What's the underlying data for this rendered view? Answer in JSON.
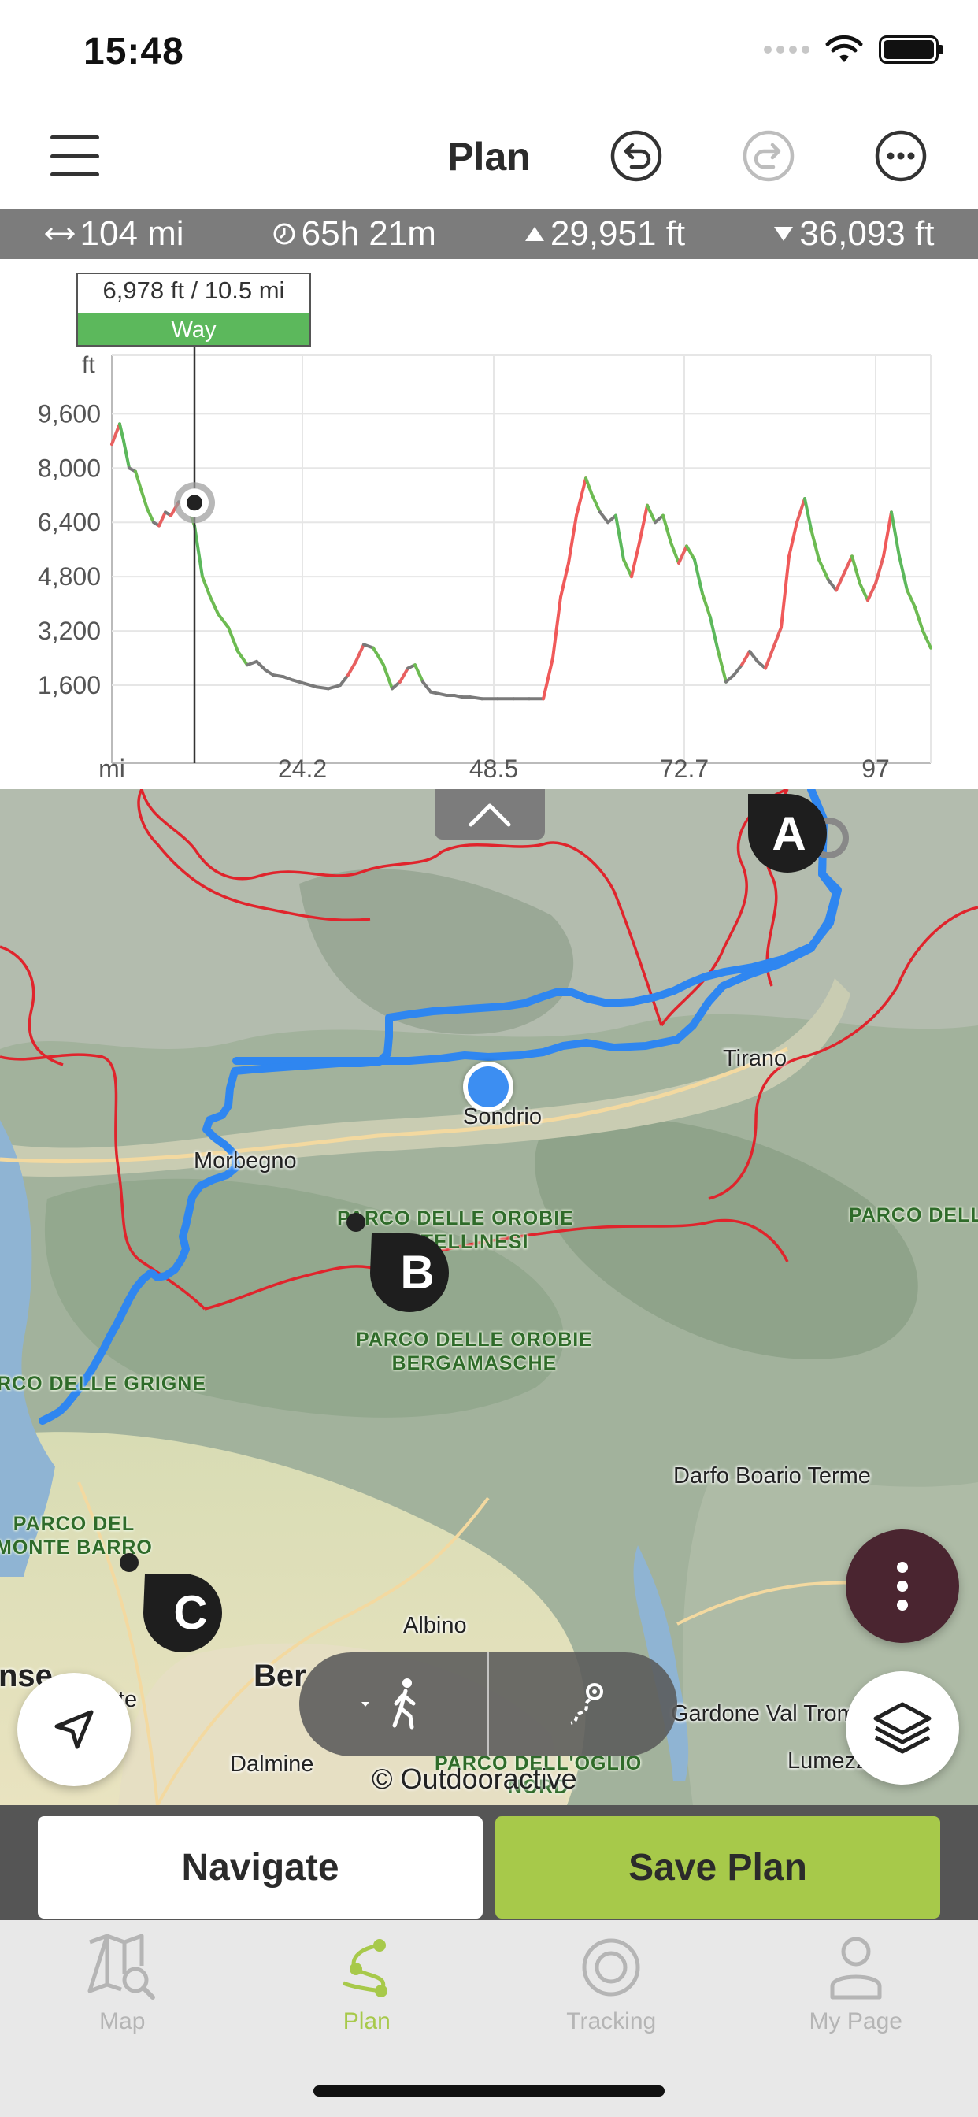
{
  "status_bar": {
    "time": "15:48"
  },
  "header": {
    "title": "Plan",
    "menu_icon": "hamburger-menu-icon",
    "undo_icon": "undo-icon",
    "redo_icon": "redo-icon",
    "more_icon": "more-horizontal-icon"
  },
  "stats": {
    "distance": "104 mi",
    "duration": "65h 21m",
    "ascent": "29,951 ft",
    "descent": "36,093 ft"
  },
  "chart_data": {
    "type": "line",
    "ylabel": "ft",
    "xlabel": "mi",
    "y_ticks": [
      "9,600",
      "8,000",
      "6,400",
      "4,800",
      "3,200",
      "1,600"
    ],
    "x_ticks": [
      "24.2",
      "48.5",
      "72.7",
      "97"
    ],
    "xlim": [
      0,
      104
    ],
    "ylim": [
      0,
      11000
    ],
    "tooltip": {
      "value": "6,978 ft / 10.5 mi",
      "surface": "Way"
    },
    "marker": {
      "x": 10.5,
      "y": 6978
    },
    "series": [
      {
        "x": [
          0,
          1,
          1.5,
          2.2,
          3,
          3.8,
          4.5,
          5.3,
          6,
          6.8,
          7.5,
          8.5,
          9.5,
          10.5,
          11.5,
          12.5,
          13.5,
          14.8,
          16,
          17.2,
          18.4,
          19.5,
          20.5,
          21.8,
          23,
          24.5,
          26,
          27.5,
          29,
          30,
          31,
          32,
          33.2,
          34.5,
          35.6,
          36.6,
          37.6,
          38.5,
          39.5,
          40.5,
          41.5,
          42.5,
          43.5,
          44.5,
          45.5,
          47,
          49,
          51,
          53,
          54.8,
          56,
          57,
          58,
          59,
          60.2,
          61,
          62,
          63,
          64,
          65,
          66,
          67,
          68,
          69,
          70,
          71,
          72,
          73,
          74,
          75,
          76,
          77,
          78,
          79,
          80,
          81,
          82,
          83,
          84,
          85,
          86,
          87,
          88,
          88.8,
          89.8,
          91,
          92,
          93,
          94,
          95,
          96,
          97,
          98,
          99,
          100,
          101,
          102,
          103,
          104
        ],
        "y": [
          8700,
          9300,
          8800,
          8000,
          7900,
          7300,
          6800,
          6400,
          6300,
          6700,
          6600,
          7000,
          6978,
          6300,
          4800,
          4200,
          3700,
          3300,
          2600,
          2200,
          2300,
          2050,
          1900,
          1850,
          1750,
          1650,
          1550,
          1500,
          1600,
          1900,
          2300,
          2800,
          2700,
          2200,
          1500,
          1700,
          2100,
          2200,
          1700,
          1400,
          1350,
          1300,
          1300,
          1250,
          1250,
          1200,
          1200,
          1200,
          1200,
          1200,
          2400,
          4200,
          5200,
          6600,
          7700,
          7200,
          6700,
          6400,
          6600,
          5300,
          4800,
          5800,
          6900,
          6400,
          6600,
          5800,
          5200,
          5700,
          5300,
          4300,
          3600,
          2600,
          1700,
          1900,
          2200,
          2600,
          2300,
          2100,
          2700,
          3300,
          5400,
          6400,
          7100,
          6200,
          5300,
          4700,
          4400,
          4900,
          5400,
          4600,
          4100,
          4600,
          5400,
          6700,
          5400,
          4400,
          3900,
          3200,
          2700
        ]
      }
    ]
  },
  "map": {
    "places": {
      "sondrio": "Sondrio",
      "tirano": "Tirano",
      "morbegno": "Morbegno",
      "darfo": "Darfo Boario Terme",
      "albino": "Albino",
      "dalmine": "Dalmine",
      "gardone": "Gardone Val Tromp",
      "lumezzane": "Lumezz",
      "bergamo": "Ber",
      "nse": "nse",
      "te": "te"
    },
    "parks": {
      "orobie_valtellinesi": "PARCO DELLE OROBIE\nVALTELLINESI",
      "orobie_bergamasche": "PARCO DELLE OROBIE\nBERGAMASCHE",
      "grigne": "RCO DELLE GRIGNE",
      "monte_barro": "PARCO DEL\nMONTE BARRO",
      "oglio": "PARCO DELL'OGLIO\nNORD",
      "east": "PARCO DELL"
    },
    "waypoints": [
      "A",
      "B",
      "C"
    ],
    "copyright": "© Outdooractive",
    "route_color": "#3a8ff0",
    "border_color": "#e0242c"
  },
  "actions": {
    "navigate": "Navigate",
    "save_plan": "Save Plan"
  },
  "tabs": [
    {
      "label": "Map",
      "icon": "map-search-icon"
    },
    {
      "label": "Plan",
      "icon": "route-plan-icon",
      "active": true
    },
    {
      "label": "Tracking",
      "icon": "tracking-target-icon"
    },
    {
      "label": "My Page",
      "icon": "user-icon"
    }
  ],
  "colors": {
    "accent_green": "#a7c94a",
    "fab_maroon": "#4a2530",
    "stats_gray": "#7c7c7c",
    "way_green": "#5cb85c"
  }
}
